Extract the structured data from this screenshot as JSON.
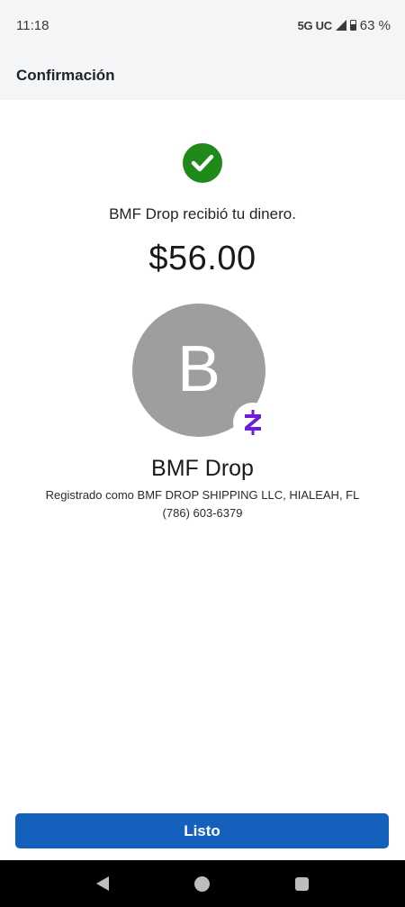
{
  "status_bar": {
    "time": "11:18",
    "network": "5G UC",
    "battery": "63 %"
  },
  "header": {
    "title": "Confirmación"
  },
  "confirmation": {
    "message": "BMF Drop recibió tu dinero.",
    "amount": "$56.00",
    "success_color": "#1f8a1a"
  },
  "recipient": {
    "avatar_letter": "B",
    "name": "BMF Drop",
    "registered_as": "Registrado como BMF DROP SHIPPING LLC, HIALEAH, FL",
    "phone": "(786) 603-6379",
    "badge_icon": "zelle-logo-icon",
    "brand_color": "#6d1ed4"
  },
  "actions": {
    "done_label": "Listo",
    "button_color": "#1560bd"
  },
  "nav": {
    "icons": [
      "back-icon",
      "home-icon",
      "recents-icon"
    ]
  }
}
